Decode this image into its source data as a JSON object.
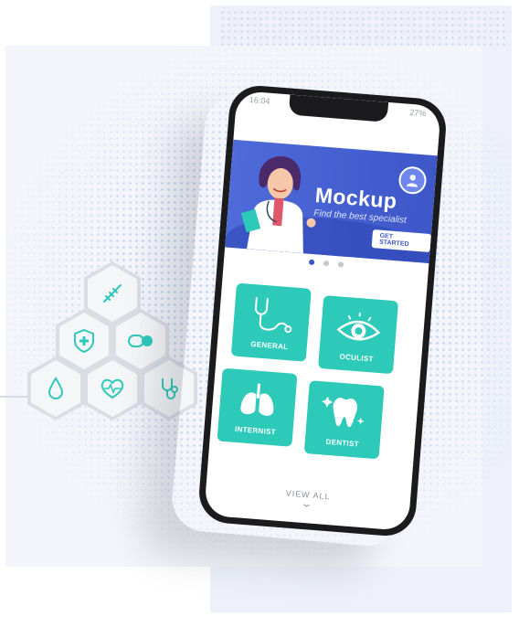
{
  "status_bar": {
    "time": "16:04",
    "battery": "27%"
  },
  "banner": {
    "title": "Mockup",
    "subtitle": "Find the best specialist",
    "cta_label": "GET STARTED"
  },
  "carousel": {
    "count": 3,
    "active_index": 0
  },
  "categories": [
    {
      "label": "GENERAL",
      "icon": "stethoscope-icon"
    },
    {
      "label": "OCULIST",
      "icon": "eye-icon"
    },
    {
      "label": "INTERNIST",
      "icon": "lungs-icon"
    },
    {
      "label": "DENTIST",
      "icon": "tooth-icon"
    }
  ],
  "view_all_label": "VIEW ALL",
  "hex_icons": [
    "dna-icon",
    "shield-plus-icon",
    "pill-icon",
    "drop-icon",
    "heart-pulse-icon",
    "stethoscope-icon"
  ],
  "colors": {
    "accent": "#2dc9b9",
    "banner": "#3d57c9",
    "phone": "#1b1b1d"
  }
}
